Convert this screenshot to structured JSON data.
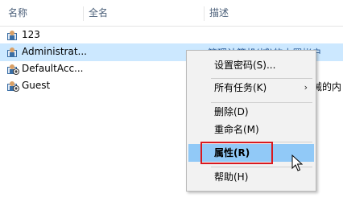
{
  "columns": [
    "名称",
    "全名",
    "描述"
  ],
  "users": [
    {
      "name": "123",
      "description": "",
      "selected": false
    },
    {
      "name": "Administrat...",
      "description": "管理计算机(域)的内置帐户",
      "selected": true
    },
    {
      "name": "DefaultAcc...",
      "description": "",
      "selected": false
    },
    {
      "name": "Guest",
      "description": "械的内",
      "selected": false
    }
  ],
  "context_menu": {
    "items": [
      {
        "label": "设置密码(S)..."
      },
      {
        "label": "所有任务(K)",
        "submenu_arrow": "›"
      },
      {
        "label": "删除(D)"
      },
      {
        "label": "重命名(M)"
      },
      {
        "label": "属性(R)",
        "highlighted": true
      },
      {
        "label": "帮助(H)"
      }
    ]
  },
  "colors": {
    "selection": "#cce8ff",
    "menu_highlight": "#91c9f7",
    "annotation_box": "#d9191f"
  }
}
